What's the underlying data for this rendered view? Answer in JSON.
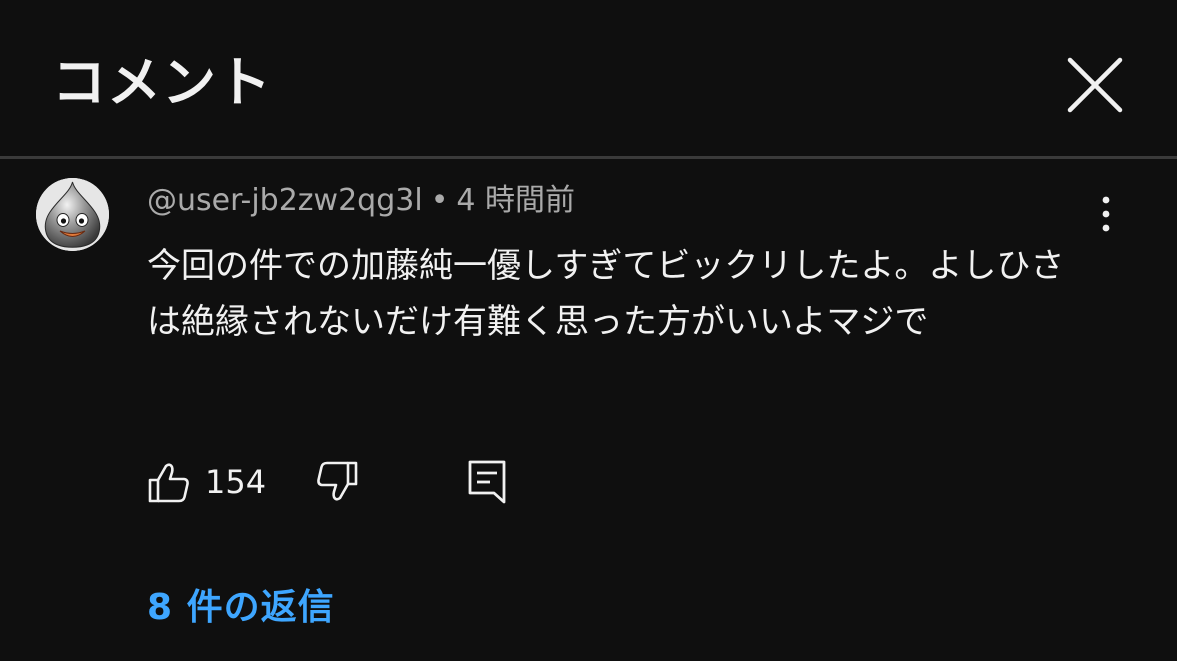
{
  "header": {
    "title": "コメント"
  },
  "comment": {
    "author": "@user-jb2zw2qg3l",
    "separator": "•",
    "timestamp": "4 時間前",
    "text": "今回の件での加藤純一優しすぎてビックリしたよ。よしひさは絶縁されないだけ有難く思った方がいいよマジで",
    "like_count": "154"
  },
  "replies": {
    "label": "8 件の返信"
  },
  "icons": {
    "close": "close-icon",
    "more": "more-vert-icon",
    "like": "thumbs-up-icon",
    "dislike": "thumbs-down-icon",
    "reply": "reply-icon"
  },
  "colors": {
    "background": "#0f0f0f",
    "text": "#f1f1f1",
    "secondary_text": "#aaaaaa",
    "link": "#3ea6ff"
  }
}
